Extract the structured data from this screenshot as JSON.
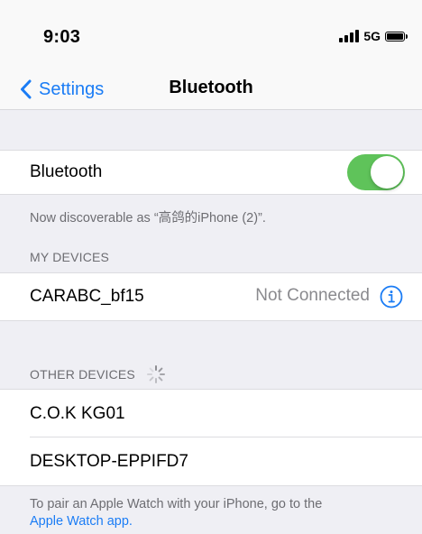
{
  "status_bar": {
    "time": "9:03",
    "network": "5G"
  },
  "nav": {
    "back_label": "Settings",
    "title": "Bluetooth"
  },
  "bluetooth_toggle": {
    "label": "Bluetooth",
    "on": true,
    "color": "#5fc35a"
  },
  "discoverable_text": "Now discoverable as “高鸽的iPhone (2)”.",
  "my_devices": {
    "header": "MY DEVICES",
    "items": [
      {
        "name": "CARABC_bf15",
        "status": "Not Connected",
        "icon": "info-icon"
      }
    ]
  },
  "other_devices": {
    "header": "OTHER DEVICES",
    "items": [
      {
        "name": "C.O.K KG01"
      },
      {
        "name": "DESKTOP-EPPIFD7"
      }
    ]
  },
  "footer": {
    "text": "To pair an Apple Watch with your iPhone, go to the",
    "link": "Apple Watch app."
  },
  "colors": {
    "accent": "#1a7cf5",
    "background": "#efeff4"
  }
}
